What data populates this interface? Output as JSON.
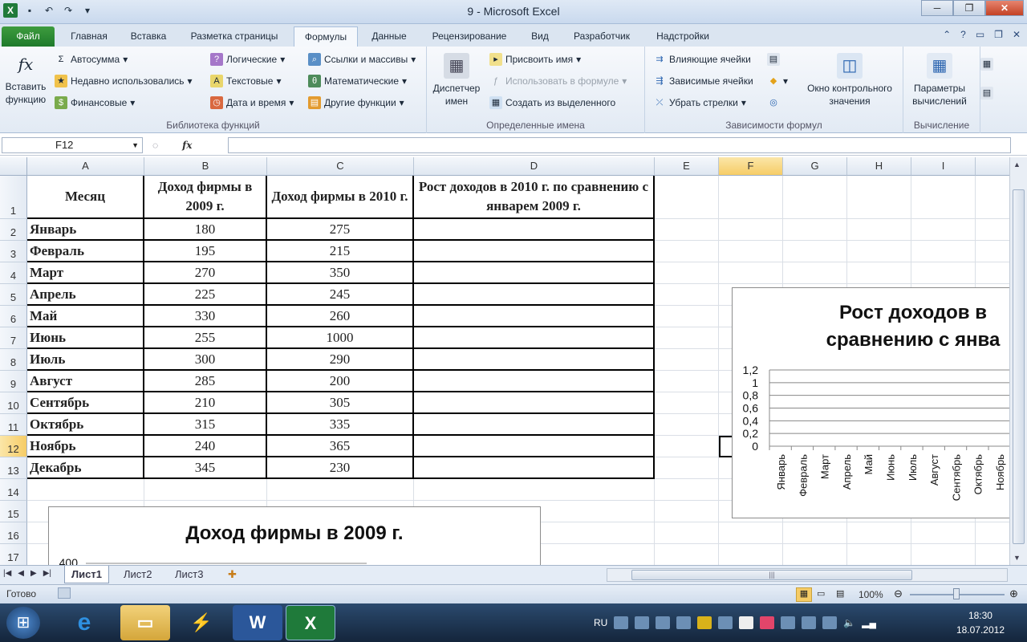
{
  "window": {
    "title": "9 - Microsoft Excel",
    "minimize": "─",
    "maximize": "❐",
    "close": "✕"
  },
  "qat": {
    "undo": "↶",
    "redo": "↷",
    "customize": "▾"
  },
  "tabs": [
    "Файл",
    "Главная",
    "Вставка",
    "Разметка страницы",
    "Формулы",
    "Данные",
    "Рецензирование",
    "Вид",
    "Разработчик",
    "Надстройки"
  ],
  "active_tab": "Формулы",
  "ribbon": {
    "insert_function": "Вставить функцию",
    "library": {
      "autosum": "Автосумма",
      "recent": "Недавно использовались",
      "financial": "Финансовые",
      "logical": "Логические",
      "text": "Текстовые",
      "datetime": "Дата и время",
      "lookup": "Ссылки и массивы",
      "math": "Математические",
      "other": "Другие функции",
      "label": "Библиотека функций"
    },
    "names": {
      "manager": "Диспетчер имен",
      "define": "Присвоить имя",
      "use_in_formula": "Использовать в формуле",
      "create_from_selection": "Создать из выделенного",
      "label": "Определенные имена"
    },
    "audit": {
      "precedents": "Влияющие ячейки",
      "dependents": "Зависимые ячейки",
      "remove_arrows": "Убрать стрелки",
      "watch": "Окно контрольного значения",
      "label": "Зависимости формул"
    },
    "calc": {
      "options": "Параметры вычислений",
      "label": "Вычисление"
    }
  },
  "formula_bar": {
    "name_box": "F12",
    "fx": "fx",
    "value": ""
  },
  "columns": [
    "A",
    "B",
    "C",
    "D",
    "E",
    "F",
    "G",
    "H",
    "I"
  ],
  "selected_col": "F",
  "selected_row": "12",
  "rows": [
    "1",
    "2",
    "3",
    "4",
    "5",
    "6",
    "7",
    "8",
    "9",
    "10",
    "11",
    "12",
    "13",
    "14",
    "15",
    "16",
    "17"
  ],
  "table": {
    "headers": [
      "Месяц",
      "Доход фирмы в 2009 г.",
      "Доход фирмы в 2010 г.",
      "Рост доходов в 2010 г. по сравнению с январем 2009 г."
    ],
    "rows": [
      [
        "Январь",
        "180",
        "275"
      ],
      [
        "Февраль",
        "195",
        "215"
      ],
      [
        "Март",
        "270",
        "350"
      ],
      [
        "Апрель",
        "225",
        "245"
      ],
      [
        "Май",
        "330",
        "260"
      ],
      [
        "Июнь",
        "255",
        "1000"
      ],
      [
        "Июль",
        "300",
        "290"
      ],
      [
        "Август",
        "285",
        "200"
      ],
      [
        "Сентябрь",
        "210",
        "305"
      ],
      [
        "Октябрь",
        "315",
        "335"
      ],
      [
        "Ноябрь",
        "240",
        "365"
      ],
      [
        "Декабрь",
        "345",
        "230"
      ]
    ]
  },
  "chart_data": [
    {
      "type": "line",
      "title": "Рост доходов в сравнению с янва",
      "categories": [
        "Январь",
        "Февраль",
        "Март",
        "Апрель",
        "Май",
        "Июнь",
        "Июль",
        "Август",
        "Сентябрь",
        "Октябрь",
        "Ноябрь"
      ],
      "yticks": [
        "1,2",
        "1",
        "0,8",
        "0,6",
        "0,4",
        "0,2",
        "0"
      ],
      "ylim": [
        0,
        1.2
      ],
      "grid": true
    },
    {
      "type": "bar",
      "title": "Доход фирмы в 2009 г.",
      "yticks": [
        "400"
      ]
    }
  ],
  "sheets": [
    "Лист1",
    "Лист2",
    "Лист3"
  ],
  "active_sheet": "Лист1",
  "status": {
    "ready": "Готово",
    "zoom": "100%"
  },
  "taskbar": {
    "lang": "RU",
    "time": "18:30",
    "date": "18.07.2012"
  }
}
